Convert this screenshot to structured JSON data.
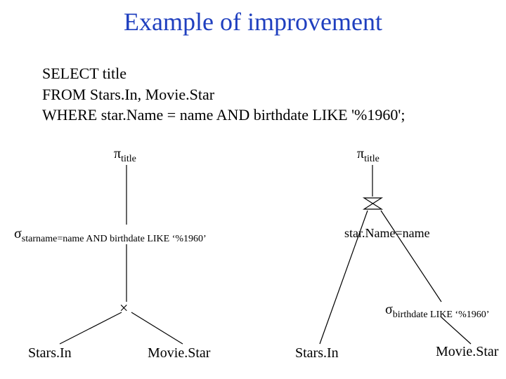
{
  "title": "Example of improvement",
  "sql": {
    "line1": "SELECT title",
    "line2": "FROM Stars.In, Movie.Star",
    "line3": "WHERE star.Name = name AND birthdate LIKE '%1960';"
  },
  "symbols": {
    "pi": "π",
    "sigma": "σ",
    "times": "×"
  },
  "left_tree": {
    "pi_sub": "title",
    "sigma_sub": "starname=name AND birthdate LIKE ‘%1960’",
    "leaf_left": "Stars.In",
    "leaf_right": "Movie.Star"
  },
  "right_tree": {
    "pi_sub": "title",
    "join_label": "star.Name=name",
    "sigma_sub": "birthdate LIKE ‘%1960’",
    "leaf_left": "Stars.In",
    "leaf_right": "Movie.Star"
  }
}
